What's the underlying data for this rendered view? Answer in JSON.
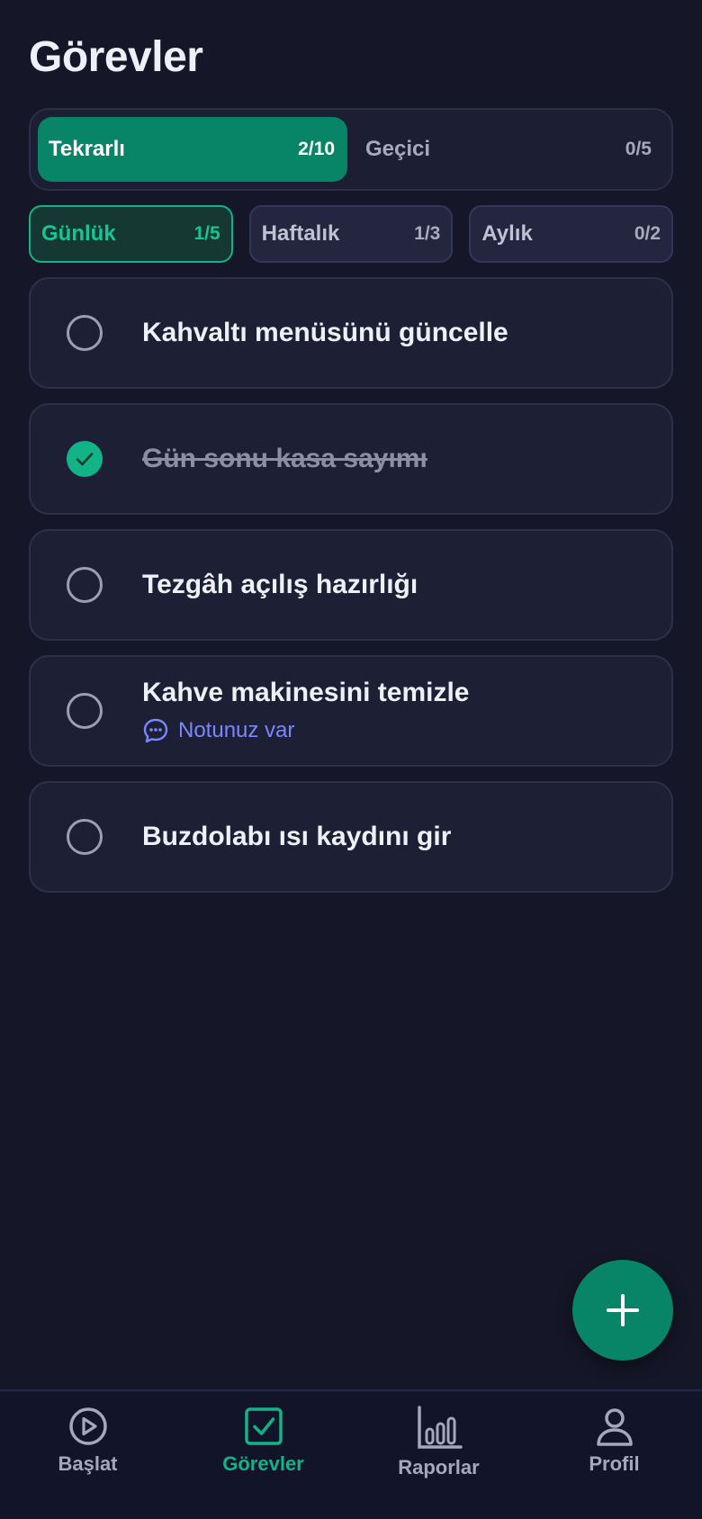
{
  "page": {
    "title": "Görevler"
  },
  "segments": [
    {
      "label": "Tekrarlı",
      "count": "2/10",
      "active": true
    },
    {
      "label": "Geçici",
      "count": "0/5",
      "active": false
    }
  ],
  "sub_filters": [
    {
      "label": "Günlük",
      "count": "1/5",
      "active": true
    },
    {
      "label": "Haftalık",
      "count": "1/3",
      "active": false
    },
    {
      "label": "Aylık",
      "count": "0/2",
      "active": false
    }
  ],
  "tasks": [
    {
      "title": "Kahvaltı menüsünü güncelle",
      "done": false,
      "note": ""
    },
    {
      "title": "Gün sonu kasa sayımı",
      "done": true,
      "note": ""
    },
    {
      "title": "Tezgâh açılış hazırlığı",
      "done": false,
      "note": ""
    },
    {
      "title": "Kahve makinesini temizle",
      "done": false,
      "note": "Notunuz var"
    },
    {
      "title": "Buzdolabı ısı kaydını gir",
      "done": false,
      "note": ""
    }
  ],
  "fab": {
    "icon": "plus-icon"
  },
  "bottom_nav": [
    {
      "label": "Başlat",
      "icon": "play-circle-icon",
      "active": false
    },
    {
      "label": "Görevler",
      "icon": "checkbox-icon",
      "active": true
    },
    {
      "label": "Raporlar",
      "icon": "bar-chart-icon",
      "active": false
    },
    {
      "label": "Profil",
      "icon": "user-icon",
      "active": false
    }
  ],
  "colors": {
    "background": "#151728",
    "accent": "#078566",
    "accent_light": "#12b386",
    "note": "#7b86ff"
  }
}
